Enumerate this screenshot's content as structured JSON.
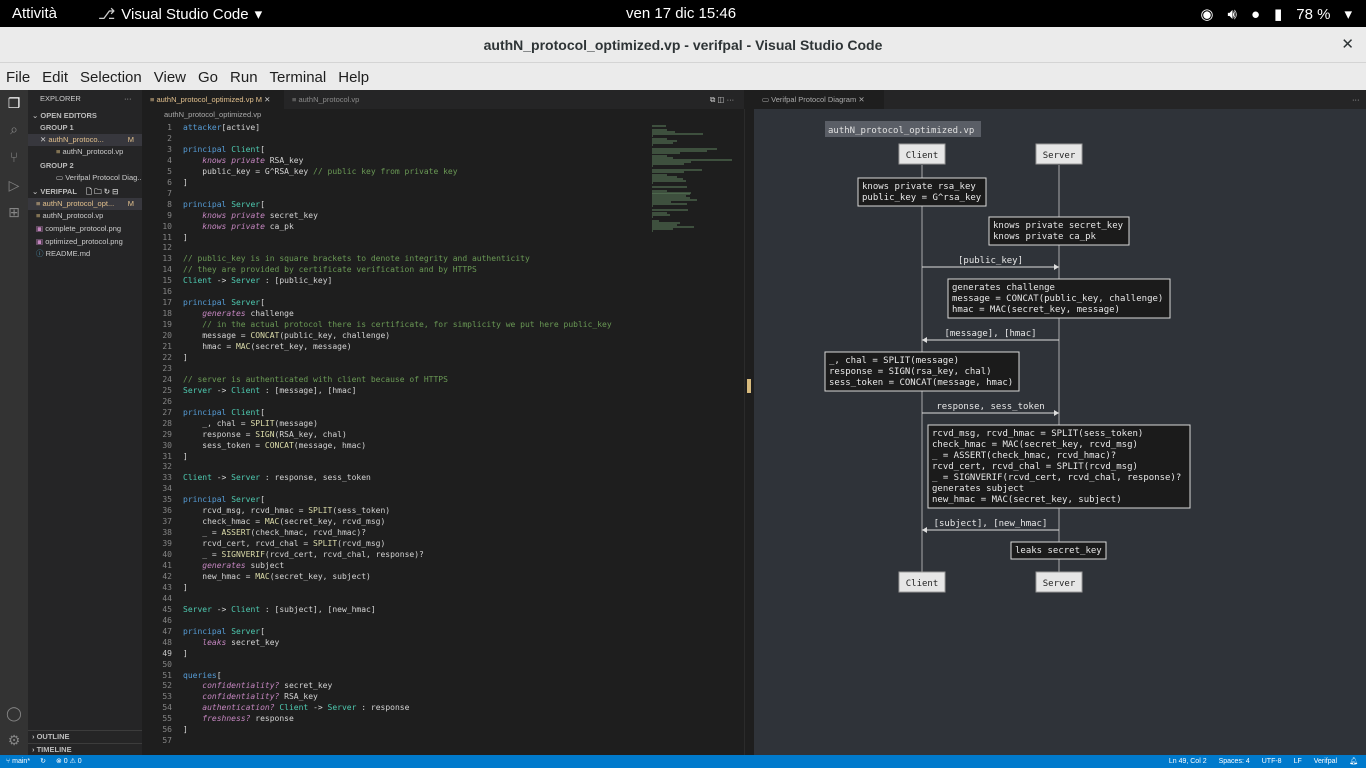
{
  "gnome": {
    "activities": "Attività",
    "app": "Visual Studio Code",
    "clock": "ven 17 dic  15:46",
    "battery": "78 %"
  },
  "window": {
    "title": "authN_protocol_optimized.vp - verifpal - Visual Studio Code"
  },
  "menu": [
    "File",
    "Edit",
    "Selection",
    "View",
    "Go",
    "Run",
    "Terminal",
    "Help"
  ],
  "sidebar": {
    "explorer": "EXPLORER",
    "open_editors": "OPEN EDITORS",
    "group1": "GROUP 1",
    "g1_file1": "authN_protoco...",
    "g1_file1_badge": "M",
    "g1_file2": "authN_protocol.vp",
    "group2": "GROUP 2",
    "g2_file1": "Verifpal Protocol Diag...",
    "folder": "VERIFPAL",
    "files": [
      {
        "name": "authN_protocol_opt...",
        "badge": "M"
      },
      {
        "name": "authN_protocol.vp",
        "badge": ""
      },
      {
        "name": "complete_protocol.png",
        "badge": ""
      },
      {
        "name": "optimized_protocol.png",
        "badge": ""
      },
      {
        "name": "README.md",
        "badge": ""
      }
    ],
    "outline": "OUTLINE",
    "timeline": "TIMELINE"
  },
  "tabs": {
    "active": "authN_protocol_optimized.vp",
    "active_badge": "M",
    "inactive": "authN_protocol.vp",
    "breadcrumb": "authN_protocol_optimized.vp",
    "diagram": "Verifpal Protocol Diagram"
  },
  "code": [
    {
      "n": "1",
      "t": "attacker[active]"
    },
    {
      "n": "2",
      "t": ""
    },
    {
      "n": "3",
      "t": "principal Client["
    },
    {
      "n": "4",
      "t": "    knows private RSA_key"
    },
    {
      "n": "5",
      "t": "    public_key = G^RSA_key // public key from private key"
    },
    {
      "n": "6",
      "t": "]"
    },
    {
      "n": "7",
      "t": ""
    },
    {
      "n": "8",
      "t": "principal Server["
    },
    {
      "n": "9",
      "t": "    knows private secret_key"
    },
    {
      "n": "10",
      "t": "    knows private ca_pk"
    },
    {
      "n": "11",
      "t": "]"
    },
    {
      "n": "12",
      "t": ""
    },
    {
      "n": "13",
      "t": "// public_key is in square brackets to denote integrity and authenticity"
    },
    {
      "n": "14",
      "t": "// they are provided by certificate verification and by HTTPS"
    },
    {
      "n": "15",
      "t": "Client -> Server : [public_key]"
    },
    {
      "n": "16",
      "t": ""
    },
    {
      "n": "17",
      "t": "principal Server["
    },
    {
      "n": "18",
      "t": "    generates challenge"
    },
    {
      "n": "19",
      "t": "    // in the actual protocol there is certificate, for simplicity we put here public_key"
    },
    {
      "n": "20",
      "t": "    message = CONCAT(public_key, challenge)"
    },
    {
      "n": "21",
      "t": "    hmac = MAC(secret_key, message)"
    },
    {
      "n": "22",
      "t": "]"
    },
    {
      "n": "23",
      "t": ""
    },
    {
      "n": "24",
      "t": "// server is authenticated with client because of HTTPS"
    },
    {
      "n": "25",
      "t": "Server -> Client : [message], [hmac]"
    },
    {
      "n": "26",
      "t": ""
    },
    {
      "n": "27",
      "t": "principal Client["
    },
    {
      "n": "28",
      "t": "    _, chal = SPLIT(message)"
    },
    {
      "n": "29",
      "t": "    response = SIGN(RSA_key, chal)"
    },
    {
      "n": "30",
      "t": "    sess_token = CONCAT(message, hmac)"
    },
    {
      "n": "31",
      "t": "]"
    },
    {
      "n": "32",
      "t": ""
    },
    {
      "n": "33",
      "t": "Client -> Server : response, sess_token"
    },
    {
      "n": "34",
      "t": ""
    },
    {
      "n": "35",
      "t": "principal Server["
    },
    {
      "n": "36",
      "t": "    rcvd_msg, rcvd_hmac = SPLIT(sess_token)"
    },
    {
      "n": "37",
      "t": "    check_hmac = MAC(secret_key, rcvd_msg)"
    },
    {
      "n": "38",
      "t": "    _ = ASSERT(check_hmac, rcvd_hmac)?"
    },
    {
      "n": "39",
      "t": "    rcvd_cert, rcvd_chal = SPLIT(rcvd_msg)"
    },
    {
      "n": "40",
      "t": "    _ = SIGNVERIF(rcvd_cert, rcvd_chal, response)?"
    },
    {
      "n": "41",
      "t": "    generates subject"
    },
    {
      "n": "42",
      "t": "    new_hmac = MAC(secret_key, subject)"
    },
    {
      "n": "43",
      "t": "]"
    },
    {
      "n": "44",
      "t": ""
    },
    {
      "n": "45",
      "t": "Server -> Client : [subject], [new_hmac]"
    },
    {
      "n": "46",
      "t": ""
    },
    {
      "n": "47",
      "t": "principal Server["
    },
    {
      "n": "48",
      "t": "    leaks secret_key"
    },
    {
      "n": "49",
      "t": "]"
    },
    {
      "n": "50",
      "t": ""
    },
    {
      "n": "51",
      "t": "queries["
    },
    {
      "n": "52",
      "t": "    confidentiality? secret_key"
    },
    {
      "n": "53",
      "t": "    confidentiality? RSA_key"
    },
    {
      "n": "54",
      "t": "    authentication? Client -> Server : response"
    },
    {
      "n": "55",
      "t": "    freshness? response"
    },
    {
      "n": "56",
      "t": "]"
    },
    {
      "n": "57",
      "t": ""
    }
  ],
  "diagram": {
    "title": "authN_protocol_optimized.vp",
    "client": "Client",
    "server": "Server",
    "box1": [
      "knows private rsa_key",
      "public_key = G^rsa_key"
    ],
    "box2": [
      "knows private secret_key",
      "knows private ca_pk"
    ],
    "msg1": "[public_key]",
    "box3": [
      "generates challenge",
      "message = CONCAT(public_key, challenge)",
      "hmac = MAC(secret_key, message)"
    ],
    "msg2": "[message], [hmac]",
    "box4": [
      "_, chal = SPLIT(message)",
      "response = SIGN(rsa_key, chal)",
      "sess_token = CONCAT(message, hmac)"
    ],
    "msg3": "response, sess_token",
    "box5": [
      "rcvd_msg, rcvd_hmac = SPLIT(sess_token)",
      "check_hmac = MAC(secret_key, rcvd_msg)",
      "_ = ASSERT(check_hmac, rcvd_hmac)?",
      "rcvd_cert, rcvd_chal = SPLIT(rcvd_msg)",
      "_ = SIGNVERIF(rcvd_cert, rcvd_chal, response)?",
      "generates subject",
      "new_hmac = MAC(secret_key, subject)"
    ],
    "msg4": "[subject], [new_hmac]",
    "box6": [
      "leaks secret_key"
    ]
  },
  "status": {
    "branch": "main*",
    "sync": "",
    "problems": "⊗ 0 ⚠ 0",
    "position": "Ln 49, Col 2",
    "spaces": "Spaces: 4",
    "encoding": "UTF-8",
    "eol": "LF",
    "language": "Verifpal"
  }
}
